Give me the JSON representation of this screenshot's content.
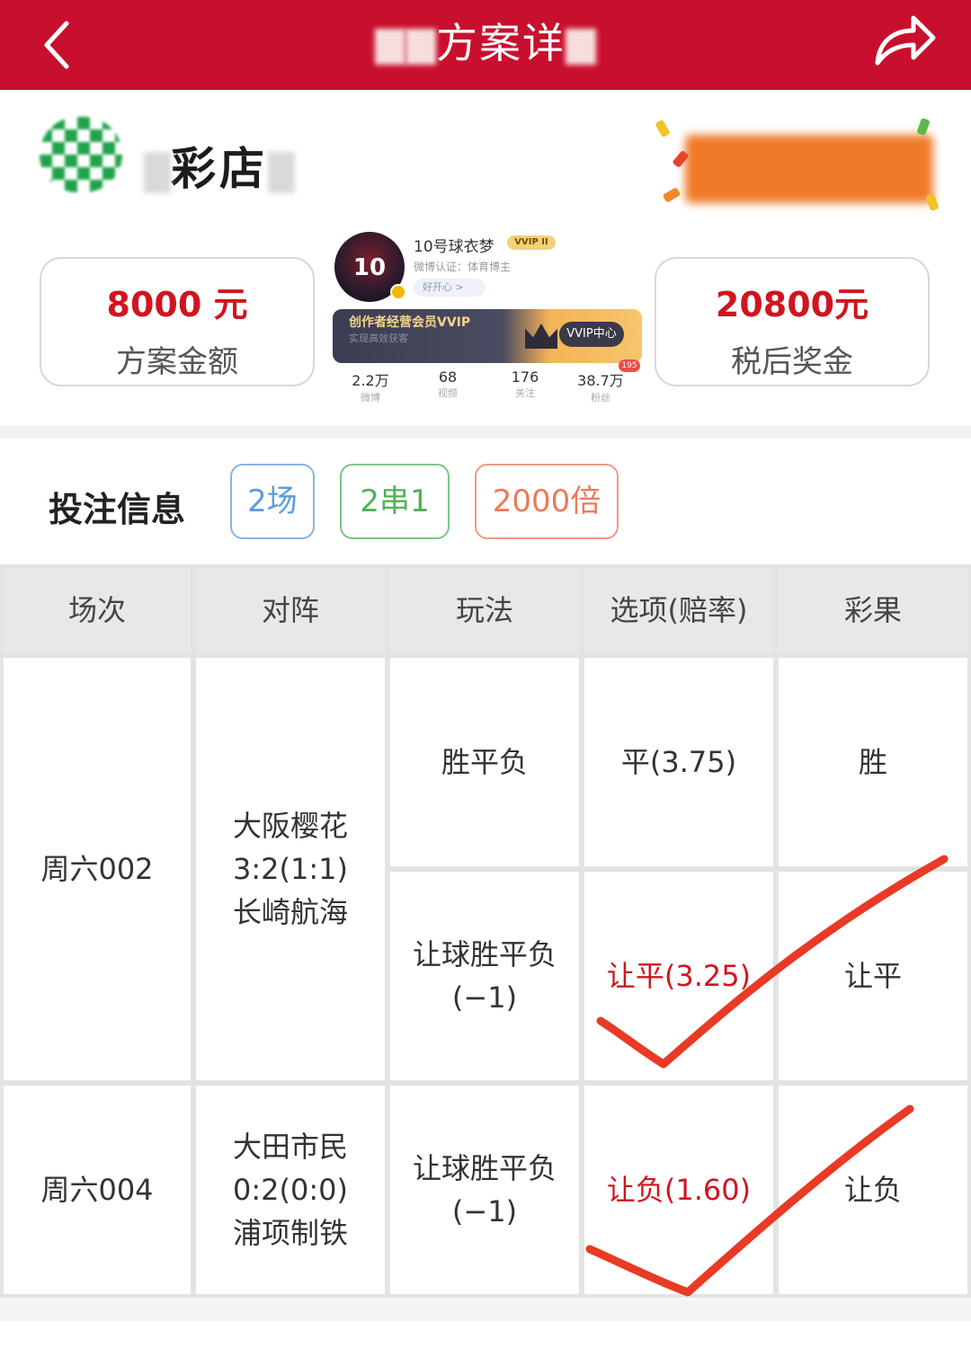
{
  "header": {
    "title_visible_1": "方案详",
    "back_icon": "chevron-left-icon",
    "share_icon": "share-arrow-icon",
    "bg_color": "#c8102e"
  },
  "brand": {
    "name_partial": "彩店"
  },
  "summary": {
    "plan_amount": "8000 元",
    "plan_amount_label": "方案金额",
    "prize": "20800元",
    "prize_label": "税后奖金"
  },
  "profile_overlay": {
    "name": "10号球衣梦",
    "vip_badge": "VVIP II",
    "cert": "微博认证：体育博主",
    "mood": "好开心 >",
    "vip_title": "创作者经营会员VVIP",
    "vip_sub": "实现高效获客",
    "vip_center": "VVIP中心",
    "stats": [
      {
        "value": "2.2万",
        "label": "微博"
      },
      {
        "value": "68",
        "label": "视频"
      },
      {
        "value": "176",
        "label": "关注"
      },
      {
        "value": "38.7万",
        "label": "粉丝"
      }
    ],
    "fans_badge": "195"
  },
  "bet_info": {
    "title": "投注信息",
    "tags": [
      "2场",
      "2串1",
      "2000倍"
    ]
  },
  "table": {
    "headers": [
      "场次",
      "对阵",
      "玩法",
      "选项(赔率)",
      "彩果"
    ],
    "matches": [
      {
        "session": "周六002",
        "home": "大阪樱花",
        "score": "3:2(1:1)",
        "away": "长崎航海",
        "bets": [
          {
            "play": "胜平负",
            "play_sub": "",
            "option": "平(3.75)",
            "result": "胜",
            "hit": false
          },
          {
            "play": "让球胜平负",
            "play_sub": "(−1)",
            "option": "让平(3.25)",
            "result": "让平",
            "hit": true
          }
        ]
      },
      {
        "session": "周六004",
        "home": "大田市民",
        "score": "0:2(0:0)",
        "away": "浦项制铁",
        "bets": [
          {
            "play": "让球胜平负",
            "play_sub": "(−1)",
            "option": "让负(1.60)",
            "result": "让负",
            "hit": true
          }
        ]
      }
    ]
  },
  "colors": {
    "accent_red": "#d0151f",
    "tick_red": "#e83a25",
    "tag_blue": "#5b9be0",
    "tag_green": "#52b05a",
    "tag_orange": "#ec7a58"
  }
}
